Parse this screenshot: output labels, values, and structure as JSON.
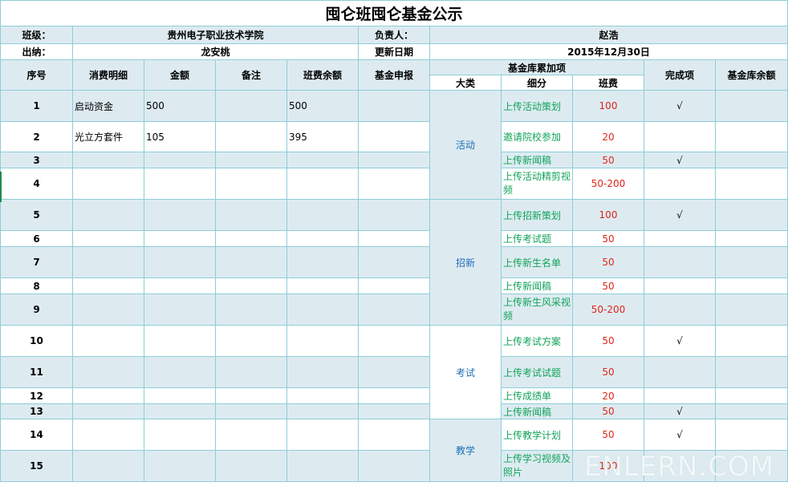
{
  "title": "囤仑班囤仑基金公示",
  "info": {
    "class_label": "班级：",
    "class_value": "贵州电子职业技术学院",
    "owner_label": "负责人：",
    "owner_value": "赵浩",
    "cashier_label": "出纳：",
    "cashier_value": "龙安桃",
    "update_label": "更新日期",
    "update_value": "2015年12月30日"
  },
  "headers": {
    "index": "序号",
    "detail": "消费明细",
    "amount": "金额",
    "note": "备注",
    "balance": "班费余额",
    "fund_apply": "基金申报",
    "fund_bonus": "基金库累加项",
    "category": "大类",
    "item": "细分",
    "fee": "班费",
    "done": "完成项",
    "fund_balance": "基金库余额"
  },
  "rows": [
    {
      "n": "1",
      "detail": "启动资金",
      "amount": "500",
      "note": "",
      "balance": "500",
      "apply": "",
      "item": "上传活动策划",
      "fee": "100",
      "done": "√",
      "fund": ""
    },
    {
      "n": "2",
      "detail": "光立方套件",
      "amount": "105",
      "note": "",
      "balance": "395",
      "apply": "",
      "item": "邀请院校参加",
      "fee": "20",
      "done": "",
      "fund": ""
    },
    {
      "n": "3",
      "detail": "",
      "amount": "",
      "note": "",
      "balance": "",
      "apply": "",
      "item": "上传新闻稿",
      "fee": "50",
      "done": "√",
      "fund": ""
    },
    {
      "n": "4",
      "detail": "",
      "amount": "",
      "note": "",
      "balance": "",
      "apply": "",
      "item": "上传活动精剪视频",
      "fee": "50-200",
      "done": "",
      "fund": ""
    },
    {
      "n": "5",
      "detail": "",
      "amount": "",
      "note": "",
      "balance": "",
      "apply": "",
      "item": "上传招新策划",
      "fee": "100",
      "done": "√",
      "fund": ""
    },
    {
      "n": "6",
      "detail": "",
      "amount": "",
      "note": "",
      "balance": "",
      "apply": "",
      "item": "上传考试题",
      "fee": "50",
      "done": "",
      "fund": ""
    },
    {
      "n": "7",
      "detail": "",
      "amount": "",
      "note": "",
      "balance": "",
      "apply": "",
      "item": "上传新生名单",
      "fee": "50",
      "done": "",
      "fund": ""
    },
    {
      "n": "8",
      "detail": "",
      "amount": "",
      "note": "",
      "balance": "",
      "apply": "",
      "item": "上传新闻稿",
      "fee": "50",
      "done": "",
      "fund": ""
    },
    {
      "n": "9",
      "detail": "",
      "amount": "",
      "note": "",
      "balance": "",
      "apply": "",
      "item": "上传新生风采视频",
      "fee": "50-200",
      "done": "",
      "fund": ""
    },
    {
      "n": "10",
      "detail": "",
      "amount": "",
      "note": "",
      "balance": "",
      "apply": "",
      "item": "上传考试方案",
      "fee": "50",
      "done": "√",
      "fund": ""
    },
    {
      "n": "11",
      "detail": "",
      "amount": "",
      "note": "",
      "balance": "",
      "apply": "",
      "item": "上传考试试题",
      "fee": "50",
      "done": "",
      "fund": ""
    },
    {
      "n": "12",
      "detail": "",
      "amount": "",
      "note": "",
      "balance": "",
      "apply": "",
      "item": "上传成绩单",
      "fee": "20",
      "done": "",
      "fund": ""
    },
    {
      "n": "13",
      "detail": "",
      "amount": "",
      "note": "",
      "balance": "",
      "apply": "",
      "item": "上传新闻稿",
      "fee": "50",
      "done": "√",
      "fund": ""
    },
    {
      "n": "14",
      "detail": "",
      "amount": "",
      "note": "",
      "balance": "",
      "apply": "",
      "item": "上传教学计划",
      "fee": "50",
      "done": "√",
      "fund": ""
    },
    {
      "n": "15",
      "detail": "",
      "amount": "",
      "note": "",
      "balance": "",
      "apply": "",
      "item": "上传学习视频及照片",
      "fee": "100",
      "done": "",
      "fund": ""
    }
  ],
  "categories": [
    "活动",
    "招新",
    "考试",
    "教学"
  ],
  "watermark": "ENLERN.COM"
}
